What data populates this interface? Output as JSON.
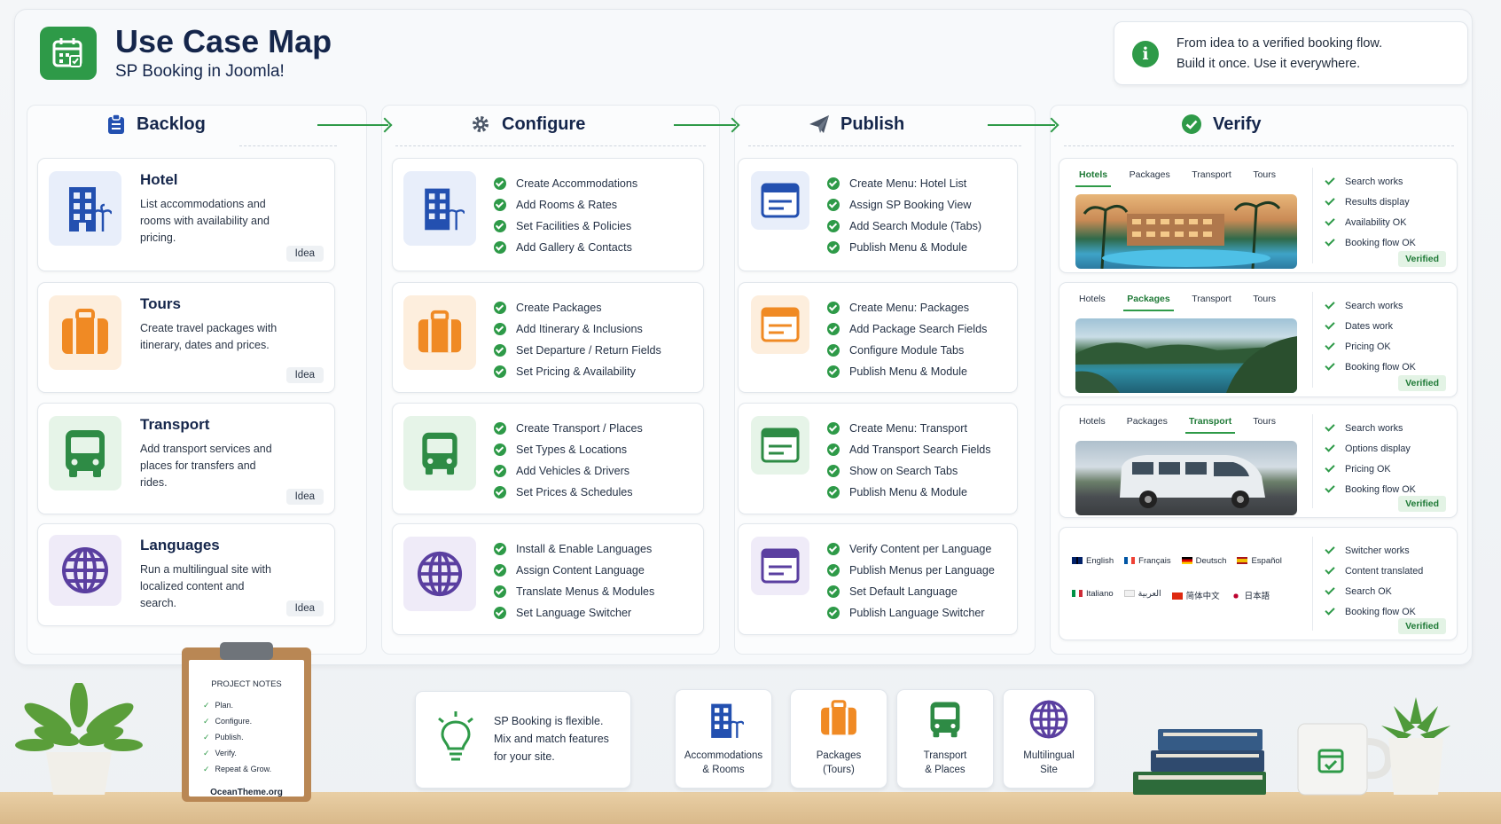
{
  "header": {
    "title": "Use Case Map",
    "subtitle": "SP Booking in Joomla!",
    "info_line1": "From idea to a verified booking flow.",
    "info_line2": "Build it once. Use it everywhere."
  },
  "columns": {
    "backlog": "Backlog",
    "configure": "Configure",
    "publish": "Publish",
    "verify": "Verify"
  },
  "backlog": [
    {
      "title": "Hotel",
      "desc": "List accommodations and rooms with availability and pricing.",
      "tag": "Idea"
    },
    {
      "title": "Tours",
      "desc": "Create travel packages with itinerary, dates and prices.",
      "tag": "Idea"
    },
    {
      "title": "Transport",
      "desc": "Add transport services and places for transfers and rides.",
      "tag": "Idea"
    },
    {
      "title": "Languages",
      "desc": "Run a multilingual site with localized content and search.",
      "tag": "Idea"
    }
  ],
  "configure": [
    {
      "items": [
        "Create Accommodations",
        "Add Rooms & Rates",
        "Set Facilities & Policies",
        "Add Gallery & Contacts"
      ]
    },
    {
      "items": [
        "Create Packages",
        "Add Itinerary & Inclusions",
        "Set Departure / Return Fields",
        "Set Pricing & Availability"
      ]
    },
    {
      "items": [
        "Create Transport / Places",
        "Set Types & Locations",
        "Add Vehicles & Drivers",
        "Set Prices & Schedules"
      ]
    },
    {
      "items": [
        "Install & Enable Languages",
        "Assign Content Language",
        "Translate Menus & Modules",
        "Set Language Switcher"
      ]
    }
  ],
  "publish": [
    {
      "items": [
        "Create Menu: Hotel List",
        "Assign SP Booking View",
        "Add Search Module (Tabs)",
        "Publish Menu & Module"
      ]
    },
    {
      "items": [
        "Create Menu: Packages",
        "Add Package Search Fields",
        "Configure Module Tabs",
        "Publish Menu & Module"
      ]
    },
    {
      "items": [
        "Create Menu: Transport",
        "Add Transport Search Fields",
        "Show on Search Tabs",
        "Publish Menu & Module"
      ]
    },
    {
      "items": [
        "Verify Content per Language",
        "Publish Menus per Language",
        "Set Default Language",
        "Publish Language Switcher"
      ]
    }
  ],
  "verify": {
    "tabs": [
      "Hotels",
      "Packages",
      "Transport",
      "Tours"
    ],
    "cards": [
      {
        "active_tab": 0,
        "checks": [
          "Search works",
          "Results display",
          "Availability OK",
          "Booking flow OK"
        ],
        "badge": "Verified"
      },
      {
        "active_tab": 1,
        "checks": [
          "Search works",
          "Dates work",
          "Pricing OK",
          "Booking flow OK"
        ],
        "badge": "Verified"
      },
      {
        "active_tab": 2,
        "checks": [
          "Search works",
          "Options display",
          "Pricing OK",
          "Booking flow OK"
        ],
        "badge": "Verified"
      },
      {
        "checks": [
          "Switcher works",
          "Content translated",
          "Search OK",
          "Booking flow OK"
        ],
        "badge": "Verified"
      }
    ],
    "languages_row1": [
      "English",
      "Français",
      "Deutsch",
      "Español"
    ],
    "languages_row2": [
      "Italiano",
      "العربية",
      "简体中文",
      "日本語"
    ]
  },
  "notes": {
    "title": "PROJECT NOTES",
    "items": [
      "Plan.",
      "Configure.",
      "Publish.",
      "Verify.",
      "Repeat & Grow."
    ],
    "footer": "OceanTheme.org"
  },
  "tip": {
    "line1": "SP Booking is flexible.",
    "line2": "Mix and match features",
    "line3": "for your site."
  },
  "features": [
    {
      "line1": "Accommodations",
      "line2": "& Rooms"
    },
    {
      "line1": "Packages",
      "line2": "(Tours)"
    },
    {
      "line1": "Transport",
      "line2": "& Places"
    },
    {
      "line1": "Multilingual",
      "line2": "Site"
    }
  ],
  "colors": {
    "accent": "#2e9a48",
    "navy": "#15264b",
    "hotel_blue": "#2350b0",
    "tour_orange": "#f08a24",
    "transport_green": "#2e8b45",
    "lang_purple": "#5a3fa0"
  }
}
